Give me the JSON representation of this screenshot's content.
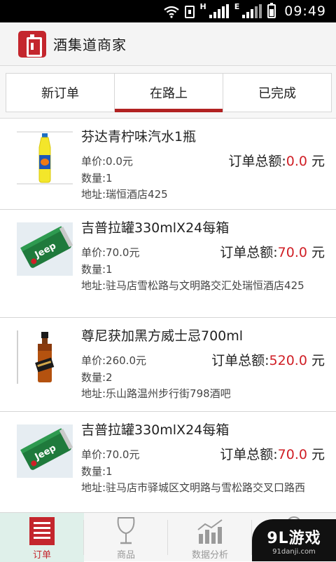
{
  "status_bar": {
    "network_1": "H",
    "network_2": "E",
    "time": "09:49",
    "icons": [
      "wifi-icon",
      "sim-icon",
      "signal-icon",
      "signal-icon",
      "battery-icon"
    ]
  },
  "header": {
    "title": "酒集道商家",
    "logo_icon": "shop-logo-icon"
  },
  "tabs": [
    {
      "label": "新订单",
      "active": false
    },
    {
      "label": "在路上",
      "active": true
    },
    {
      "label": "已完成",
      "active": false
    }
  ],
  "orders": [
    {
      "name": "芬达青柠味汽水1瓶",
      "price": "单价:0.0元",
      "qty": "数量:1",
      "total_label": "订单总额:",
      "total_amount": "0.0",
      "total_unit": " 元",
      "address": "地址:瑞恒酒店425",
      "image": "soda-bottle-image"
    },
    {
      "name": "吉普拉罐330mlX24每箱",
      "price": "单价:70.0元",
      "qty": "数量:1",
      "total_label": "订单总额:",
      "total_amount": "70.0",
      "total_unit": " 元",
      "address": "地址:驻马店雪松路与文明路交汇处瑞恒酒店425",
      "image": "beer-can-image"
    },
    {
      "name": "尊尼获加黑方威士忌700ml",
      "price": "单价:260.0元",
      "qty": "数量:2",
      "total_label": "订单总额:",
      "total_amount": "520.0",
      "total_unit": " 元",
      "address": "地址:乐山路温州步行街798酒吧",
      "image": "whisky-bottle-image"
    },
    {
      "name": "吉普拉罐330mlX24每箱",
      "price": "单价:70.0元",
      "qty": "数量:1",
      "total_label": "订单总额:",
      "total_amount": "70.0",
      "total_unit": " 元",
      "address": "地址:驻马店市驿城区文明路与雪松路交叉口路西",
      "image": "beer-can-image"
    }
  ],
  "can_text": "Jeep",
  "bottom_nav": [
    {
      "label": "订单",
      "icon": "orders-icon",
      "active": true
    },
    {
      "label": "商品",
      "icon": "wine-glass-icon",
      "active": false
    },
    {
      "label": "数据分析",
      "icon": "chart-icon",
      "active": false
    },
    {
      "label": "",
      "icon": "settings-icon",
      "active": false
    }
  ],
  "watermark": {
    "main": "9L游戏",
    "sub": "91danji.com"
  },
  "colors": {
    "accent": "#c4262d",
    "amount": "#d01f26",
    "tab_underline": "#b22222"
  }
}
